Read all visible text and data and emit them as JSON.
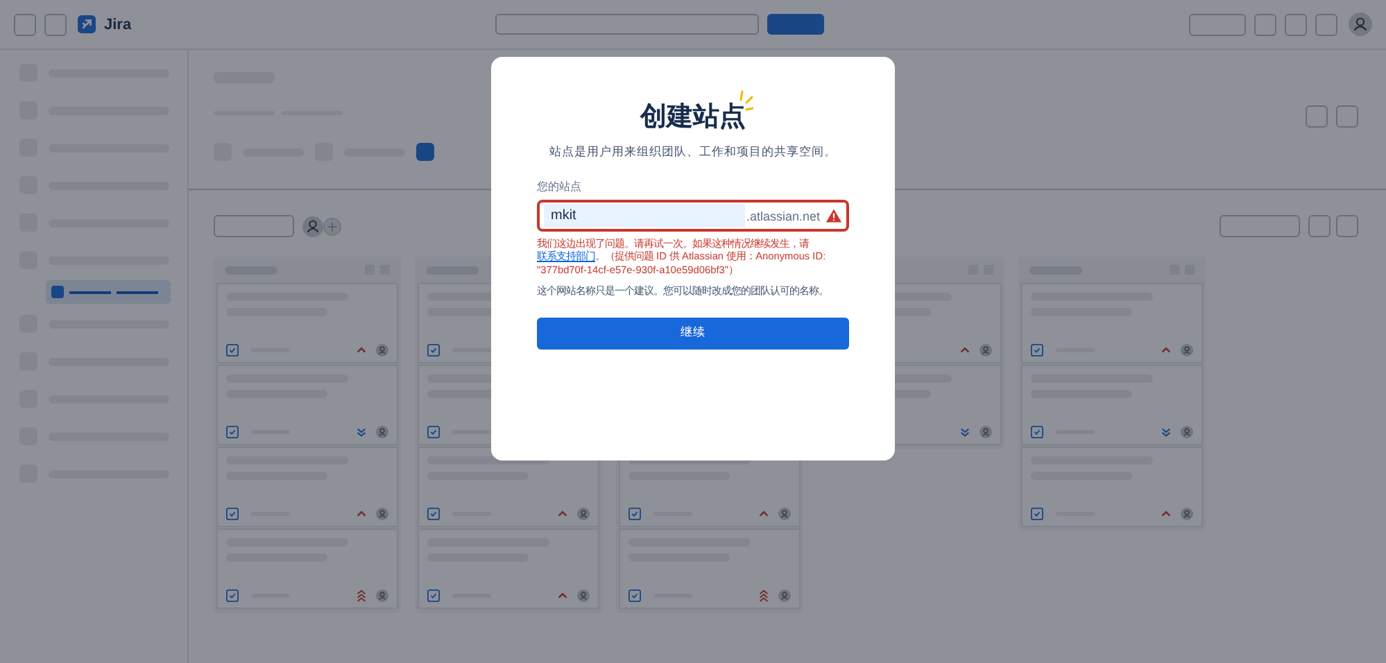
{
  "app": {
    "name": "Jira"
  },
  "board": {
    "columns": [
      {
        "kind": "open",
        "cards": [
          {
            "kind": "high"
          },
          {
            "kind": "low"
          },
          {
            "kind": "high"
          },
          {
            "kind": "highest"
          }
        ]
      },
      {
        "kind": "right-covered",
        "cards": [
          {
            "kind": "partly-covered"
          },
          {
            "kind": "partly-covered"
          },
          {
            "kind": "high"
          },
          {
            "kind": "high"
          }
        ]
      },
      {
        "kind": "covered",
        "cards": [
          {
            "kind": "covered"
          },
          {
            "kind": "covered"
          },
          {
            "kind": "high"
          },
          {
            "kind": "highest"
          }
        ]
      },
      {
        "kind": "left-covered",
        "cards": [
          {
            "kind": "high"
          },
          {
            "kind": "low"
          }
        ]
      },
      {
        "kind": "open",
        "cards": [
          {
            "kind": "high"
          },
          {
            "kind": "low"
          },
          {
            "kind": "high"
          }
        ]
      }
    ]
  },
  "dialog": {
    "title": "创建站点",
    "subtitle": "站点是用户用来组织团队、工作和项目的共享空间。",
    "site_field": {
      "label": "您的站点",
      "value": "mkit",
      "suffix": ".atlassian.net",
      "error": true
    },
    "error_message": {
      "text": "我们这边出现了问题。请再试一次。如果这种情况继续发生，请",
      "link": "联系支持部门",
      "after": "。（提供问题 ID 供 Atlassian 使用：Anonymous ID: \"377bd70f-14cf-e57e-930f-a10e59d06bf3\"）"
    },
    "hint": "这个网站名称只是一个建议。您可以随时改成您的团队认可的名称。",
    "continue_button": "继续"
  }
}
